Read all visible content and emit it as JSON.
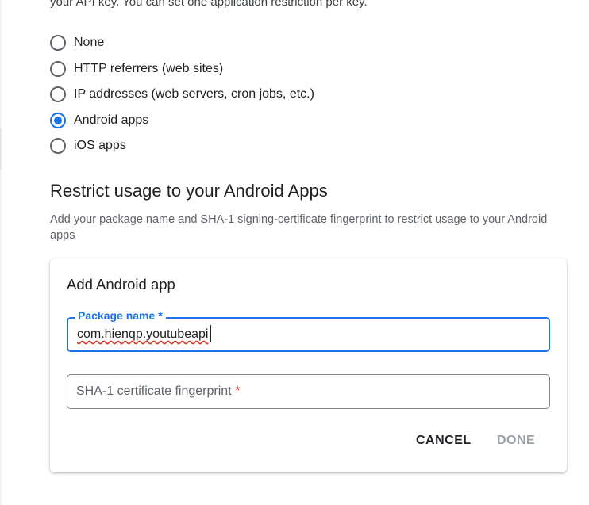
{
  "intro_text": "your API key. You can set one application restriction per key.",
  "restrictions": {
    "options": [
      {
        "label": "None",
        "checked": false
      },
      {
        "label": "HTTP referrers (web sites)",
        "checked": false
      },
      {
        "label": "IP addresses (web servers, cron jobs, etc.)",
        "checked": false
      },
      {
        "label": "Android apps",
        "checked": true
      },
      {
        "label": "iOS apps",
        "checked": false
      }
    ]
  },
  "android_section": {
    "title": "Restrict usage to your Android Apps",
    "description": "Add your package name and SHA-1 signing-certificate fingerprint to restrict usage to your Android apps"
  },
  "add_app_card": {
    "title": "Add Android app",
    "package_field": {
      "label": "Package name",
      "required_mark": "*",
      "value": "com.hienqp.youtubeapi"
    },
    "sha_field": {
      "placeholder": "SHA-1 certificate fingerprint",
      "required_mark": "*"
    },
    "cancel_label": "CANCEL",
    "done_label": "DONE"
  },
  "colors": {
    "accent": "#1a73e8",
    "required": "#d93025",
    "disabled_text": "#9aa0a6"
  }
}
